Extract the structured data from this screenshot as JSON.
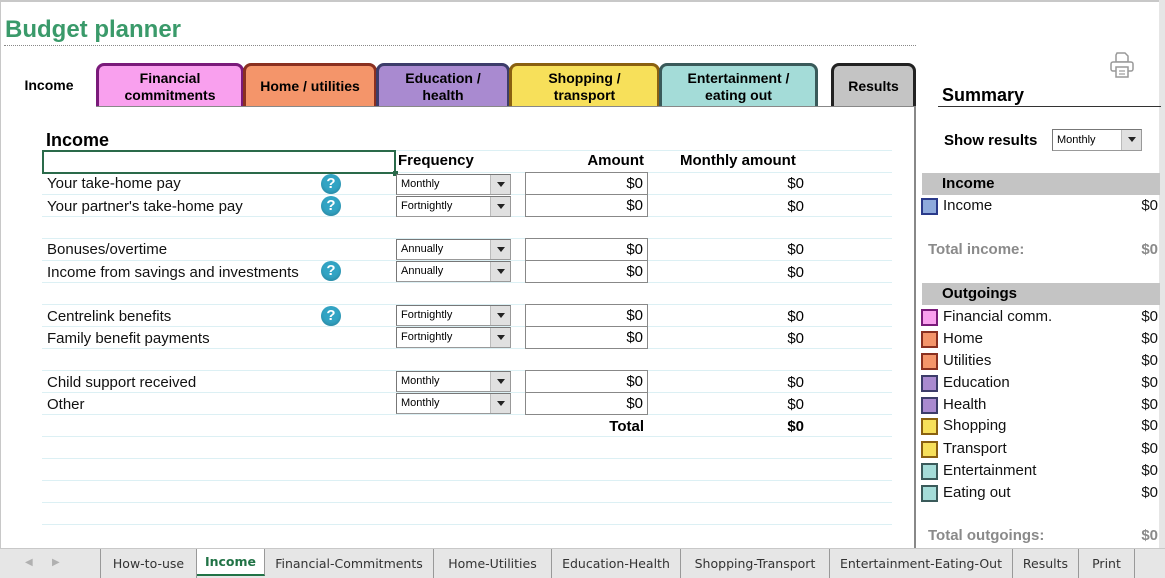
{
  "title": "Budget planner",
  "tabs": [
    {
      "label_line1": "Income",
      "label_line2": "",
      "bg": "#ffffff",
      "border": "#ffffff",
      "active": true
    },
    {
      "label_line1": "Financial",
      "label_line2": "commitments",
      "bg": "#f9a0ee",
      "border": "#7a1a7a"
    },
    {
      "label_line1": "Home / utilities",
      "label_line2": "",
      "bg": "#f4956a",
      "border": "#8a3020"
    },
    {
      "label_line1": "Education /",
      "label_line2": "health",
      "bg": "#a98ad0",
      "border": "#3c3c6a"
    },
    {
      "label_line1": "Shopping /",
      "label_line2": "transport",
      "bg": "#f7e05a",
      "border": "#8a6010"
    },
    {
      "label_line1": "Entertainment /",
      "label_line2": "eating out",
      "bg": "#a4dcd8",
      "border": "#3a5a5a"
    },
    {
      "label_line1": "Results",
      "label_line2": "",
      "bg": "#c4c4c4",
      "border": "#222222"
    }
  ],
  "main": {
    "section_title": "Income",
    "columns": {
      "frequency": "Frequency",
      "amount": "Amount",
      "monthly": "Monthly amount"
    },
    "rows": [
      {
        "label": "Your take-home pay",
        "help": true,
        "frequency": "Monthly",
        "amount": "$0",
        "monthly": "$0"
      },
      {
        "label": "Your partner's take-home pay",
        "help": true,
        "frequency": "Fortnightly",
        "amount": "$0",
        "monthly": "$0"
      },
      {
        "label": "Bonuses/overtime",
        "help": false,
        "frequency": "Annually",
        "amount": "$0",
        "monthly": "$0"
      },
      {
        "label": "Income from savings and investments",
        "help": true,
        "frequency": "Annually",
        "amount": "$0",
        "monthly": "$0"
      },
      {
        "label": "Centrelink benefits",
        "help": true,
        "frequency": "Fortnightly",
        "amount": "$0",
        "monthly": "$0"
      },
      {
        "label": "Family benefit payments",
        "help": false,
        "frequency": "Fortnightly",
        "amount": "$0",
        "monthly": "$0"
      },
      {
        "label": "Child support received",
        "help": false,
        "frequency": "Monthly",
        "amount": "$0",
        "monthly": "$0"
      },
      {
        "label": "Other",
        "help": false,
        "frequency": "Monthly",
        "amount": "$0",
        "monthly": "$0"
      }
    ],
    "help_glyph": "?",
    "total_label": "Total",
    "total_value": "$0"
  },
  "summary": {
    "print_icon": "printer-icon",
    "title": "Summary",
    "show_results_label": "Show results",
    "show_results_value": "Monthly",
    "income_head": "Income",
    "income_items": [
      {
        "label": "Income",
        "value": "$0",
        "fill": "#8eaadc",
        "border": "#2a3a8a"
      }
    ],
    "total_income_label": "Total income:",
    "total_income_value": "$0",
    "outgoings_head": "Outgoings",
    "outgoing_items": [
      {
        "label": "Financial comm.",
        "value": "$0",
        "fill": "#f9a0ee",
        "border": "#7a1a7a"
      },
      {
        "label": "Home",
        "value": "$0",
        "fill": "#f4956a",
        "border": "#8a3020"
      },
      {
        "label": "Utilities",
        "value": "$0",
        "fill": "#f4956a",
        "border": "#8a3020"
      },
      {
        "label": "Education",
        "value": "$0",
        "fill": "#a98ad0",
        "border": "#3c3c6a"
      },
      {
        "label": "Health",
        "value": "$0",
        "fill": "#a98ad0",
        "border": "#3c3c6a"
      },
      {
        "label": "Shopping",
        "value": "$0",
        "fill": "#f7e05a",
        "border": "#8a6010"
      },
      {
        "label": "Transport",
        "value": "$0",
        "fill": "#f7e05a",
        "border": "#8a6010"
      },
      {
        "label": "Entertainment",
        "value": "$0",
        "fill": "#a4dcd8",
        "border": "#3a5a5a"
      },
      {
        "label": "Eating out",
        "value": "$0",
        "fill": "#a4dcd8",
        "border": "#3a5a5a"
      }
    ],
    "total_outgoings_label": "Total outgoings:",
    "total_outgoings_value": "$0"
  },
  "sheet_tabs": {
    "prev_arrow": "◀",
    "next_arrow": "▶",
    "items": [
      "How-to-use",
      "Income",
      "Financial-Commitments",
      "Home-Utilities",
      "Education-Health",
      "Shopping-Transport",
      "Entertainment-Eating-Out",
      "Results",
      "Print"
    ],
    "active": "Income"
  }
}
